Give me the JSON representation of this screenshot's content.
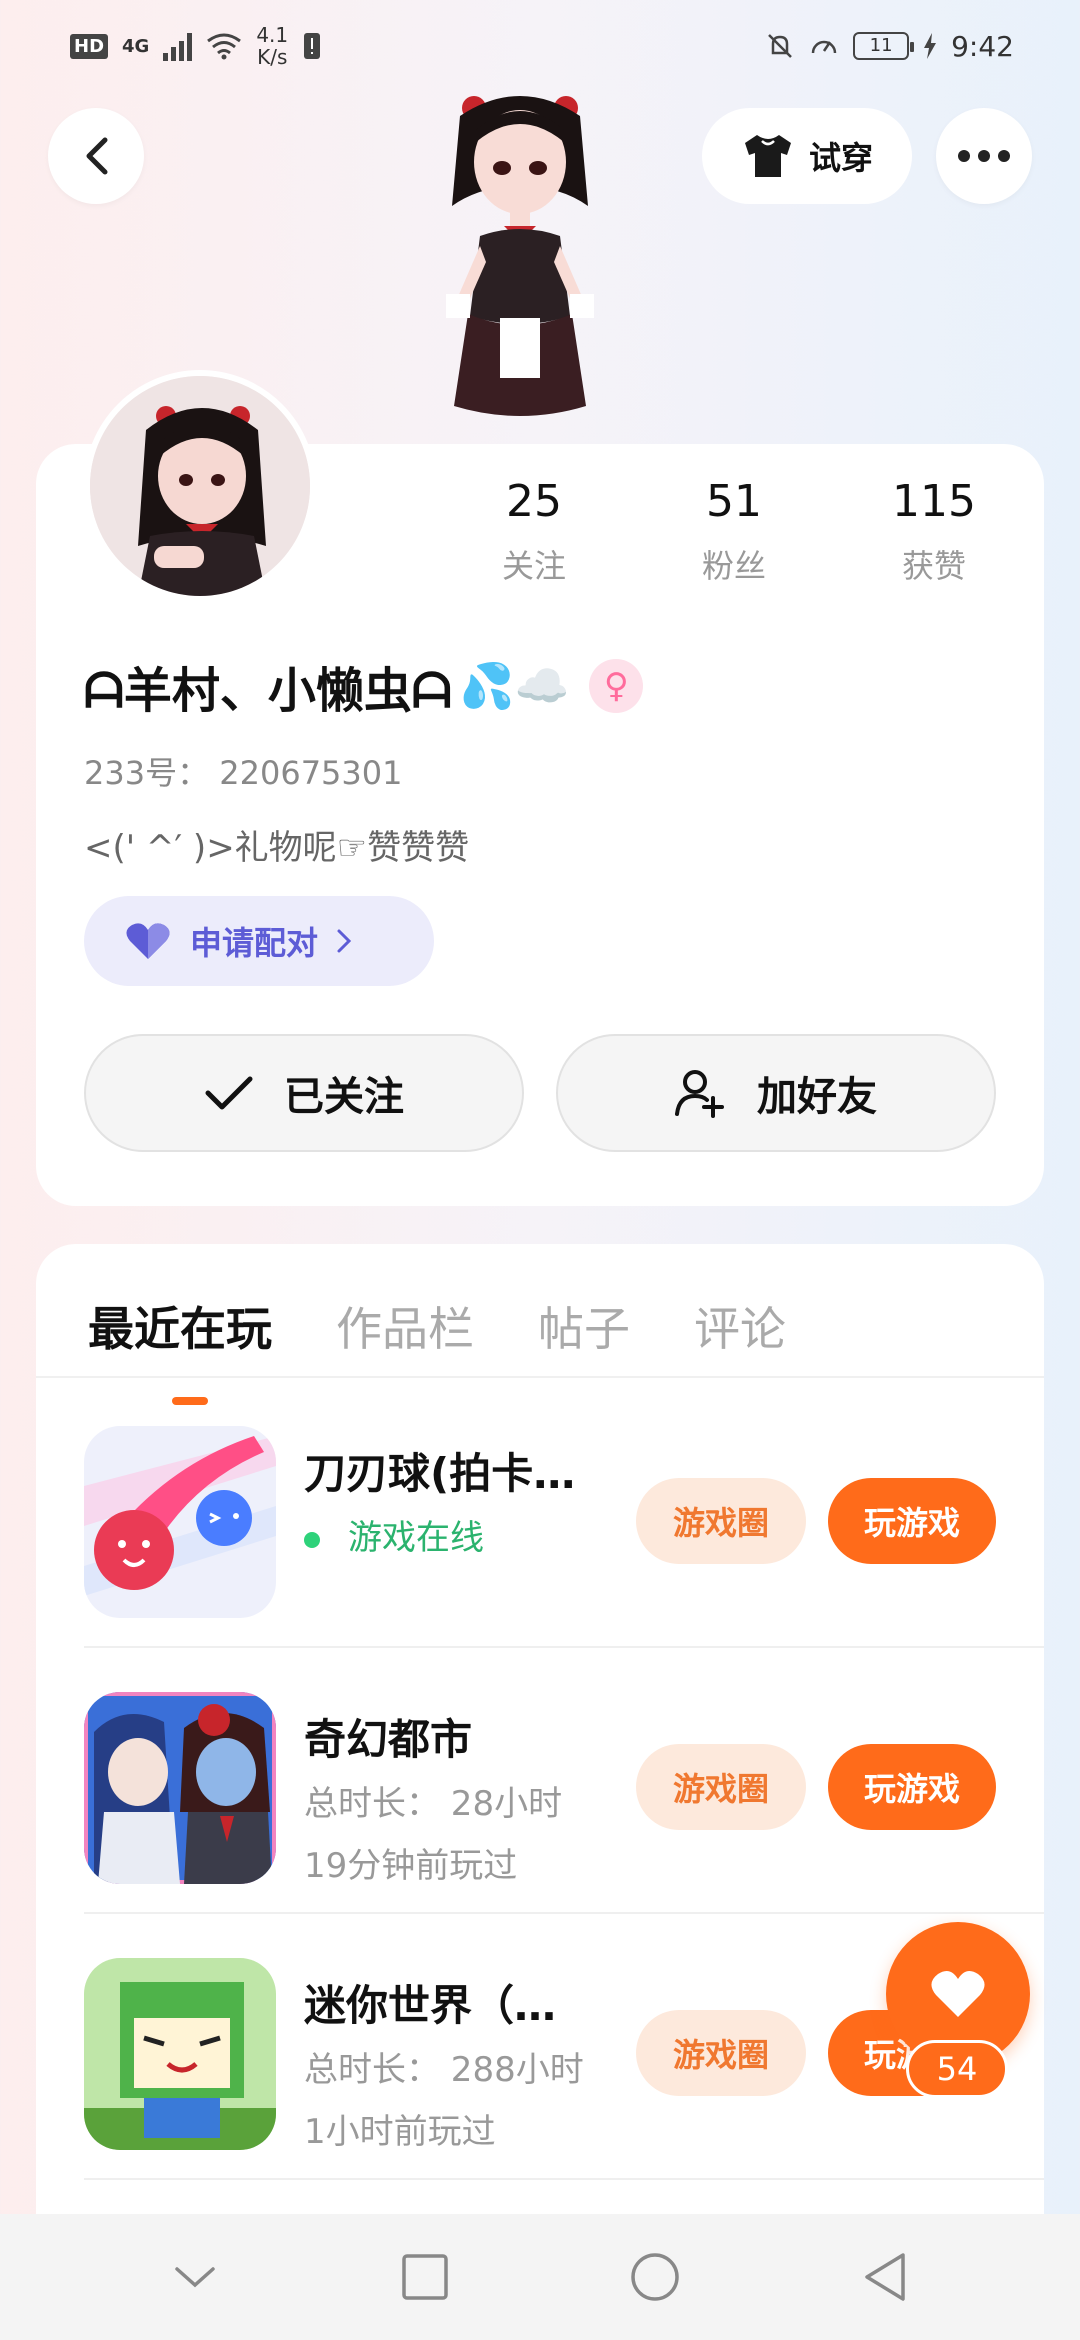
{
  "status_bar": {
    "hd": "HD",
    "network": "4G",
    "speed_value": "4.1",
    "speed_unit": "K/s",
    "battery": "11",
    "time": "9:42"
  },
  "header": {
    "tryon_label": "试穿"
  },
  "profile": {
    "nickname": "ᗩ羊村、小懒虫ᗩ",
    "nickname_emoji": "💦☁️",
    "gender_symbol": "♀",
    "user_id": "233号： 220675301",
    "bio": "<(' ^′ )>礼物呢☞赞赞赞",
    "pair_label": "申请配对",
    "followed_label": "已关注",
    "add_friend_label": "加好友",
    "stats": [
      {
        "value": "25",
        "label": "关注"
      },
      {
        "value": "51",
        "label": "粉丝"
      },
      {
        "value": "115",
        "label": "获赞"
      }
    ]
  },
  "tabs": [
    {
      "label": "最近在玩",
      "active": true
    },
    {
      "label": "作品栏",
      "active": false
    },
    {
      "label": "帖子",
      "active": false
    },
    {
      "label": "评论",
      "active": false
    }
  ],
  "games": [
    {
      "title": "刀刃球(拍卡…",
      "line1": "游戏在线",
      "line2": "",
      "online": true,
      "circle_label": "游戏圈",
      "play_label": "玩游戏"
    },
    {
      "title": "奇幻都市",
      "line1": "总时长： 28小时",
      "line2": "19分钟前玩过",
      "online": false,
      "circle_label": "游戏圈",
      "play_label": "玩游戏"
    },
    {
      "title": "迷你世界（…",
      "line1": "总时长： 288小时",
      "line2": "1小时前玩过",
      "online": false,
      "circle_label": "游戏圈",
      "play_label": "玩游戏"
    }
  ],
  "like_count": "54",
  "colors": {
    "accent": "#ff6b1a",
    "pair_bg": "#ececfb",
    "pair_text": "#5d5cd6",
    "online": "#2ed27a"
  }
}
